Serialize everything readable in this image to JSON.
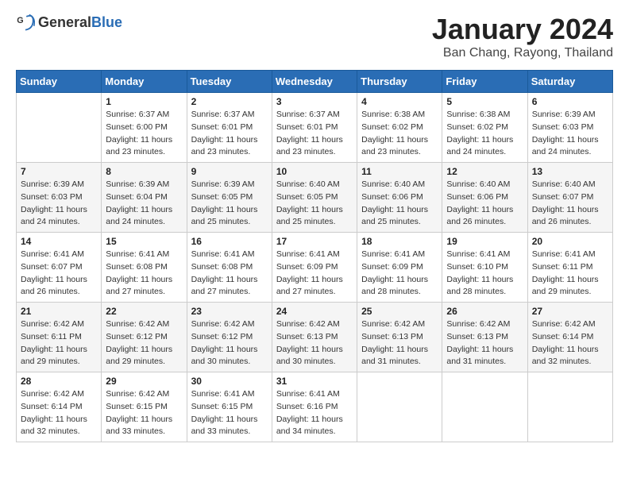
{
  "header": {
    "logo_general": "General",
    "logo_blue": "Blue",
    "main_title": "January 2024",
    "sub_title": "Ban Chang, Rayong, Thailand"
  },
  "days_of_week": [
    "Sunday",
    "Monday",
    "Tuesday",
    "Wednesday",
    "Thursday",
    "Friday",
    "Saturday"
  ],
  "weeks": [
    [
      {
        "num": "",
        "info": ""
      },
      {
        "num": "1",
        "info": "Sunrise: 6:37 AM\nSunset: 6:00 PM\nDaylight: 11 hours\nand 23 minutes."
      },
      {
        "num": "2",
        "info": "Sunrise: 6:37 AM\nSunset: 6:01 PM\nDaylight: 11 hours\nand 23 minutes."
      },
      {
        "num": "3",
        "info": "Sunrise: 6:37 AM\nSunset: 6:01 PM\nDaylight: 11 hours\nand 23 minutes."
      },
      {
        "num": "4",
        "info": "Sunrise: 6:38 AM\nSunset: 6:02 PM\nDaylight: 11 hours\nand 23 minutes."
      },
      {
        "num": "5",
        "info": "Sunrise: 6:38 AM\nSunset: 6:02 PM\nDaylight: 11 hours\nand 24 minutes."
      },
      {
        "num": "6",
        "info": "Sunrise: 6:39 AM\nSunset: 6:03 PM\nDaylight: 11 hours\nand 24 minutes."
      }
    ],
    [
      {
        "num": "7",
        "info": "Sunrise: 6:39 AM\nSunset: 6:03 PM\nDaylight: 11 hours\nand 24 minutes."
      },
      {
        "num": "8",
        "info": "Sunrise: 6:39 AM\nSunset: 6:04 PM\nDaylight: 11 hours\nand 24 minutes."
      },
      {
        "num": "9",
        "info": "Sunrise: 6:39 AM\nSunset: 6:05 PM\nDaylight: 11 hours\nand 25 minutes."
      },
      {
        "num": "10",
        "info": "Sunrise: 6:40 AM\nSunset: 6:05 PM\nDaylight: 11 hours\nand 25 minutes."
      },
      {
        "num": "11",
        "info": "Sunrise: 6:40 AM\nSunset: 6:06 PM\nDaylight: 11 hours\nand 25 minutes."
      },
      {
        "num": "12",
        "info": "Sunrise: 6:40 AM\nSunset: 6:06 PM\nDaylight: 11 hours\nand 26 minutes."
      },
      {
        "num": "13",
        "info": "Sunrise: 6:40 AM\nSunset: 6:07 PM\nDaylight: 11 hours\nand 26 minutes."
      }
    ],
    [
      {
        "num": "14",
        "info": "Sunrise: 6:41 AM\nSunset: 6:07 PM\nDaylight: 11 hours\nand 26 minutes."
      },
      {
        "num": "15",
        "info": "Sunrise: 6:41 AM\nSunset: 6:08 PM\nDaylight: 11 hours\nand 27 minutes."
      },
      {
        "num": "16",
        "info": "Sunrise: 6:41 AM\nSunset: 6:08 PM\nDaylight: 11 hours\nand 27 minutes."
      },
      {
        "num": "17",
        "info": "Sunrise: 6:41 AM\nSunset: 6:09 PM\nDaylight: 11 hours\nand 27 minutes."
      },
      {
        "num": "18",
        "info": "Sunrise: 6:41 AM\nSunset: 6:09 PM\nDaylight: 11 hours\nand 28 minutes."
      },
      {
        "num": "19",
        "info": "Sunrise: 6:41 AM\nSunset: 6:10 PM\nDaylight: 11 hours\nand 28 minutes."
      },
      {
        "num": "20",
        "info": "Sunrise: 6:41 AM\nSunset: 6:11 PM\nDaylight: 11 hours\nand 29 minutes."
      }
    ],
    [
      {
        "num": "21",
        "info": "Sunrise: 6:42 AM\nSunset: 6:11 PM\nDaylight: 11 hours\nand 29 minutes."
      },
      {
        "num": "22",
        "info": "Sunrise: 6:42 AM\nSunset: 6:12 PM\nDaylight: 11 hours\nand 29 minutes."
      },
      {
        "num": "23",
        "info": "Sunrise: 6:42 AM\nSunset: 6:12 PM\nDaylight: 11 hours\nand 30 minutes."
      },
      {
        "num": "24",
        "info": "Sunrise: 6:42 AM\nSunset: 6:13 PM\nDaylight: 11 hours\nand 30 minutes."
      },
      {
        "num": "25",
        "info": "Sunrise: 6:42 AM\nSunset: 6:13 PM\nDaylight: 11 hours\nand 31 minutes."
      },
      {
        "num": "26",
        "info": "Sunrise: 6:42 AM\nSunset: 6:13 PM\nDaylight: 11 hours\nand 31 minutes."
      },
      {
        "num": "27",
        "info": "Sunrise: 6:42 AM\nSunset: 6:14 PM\nDaylight: 11 hours\nand 32 minutes."
      }
    ],
    [
      {
        "num": "28",
        "info": "Sunrise: 6:42 AM\nSunset: 6:14 PM\nDaylight: 11 hours\nand 32 minutes."
      },
      {
        "num": "29",
        "info": "Sunrise: 6:42 AM\nSunset: 6:15 PM\nDaylight: 11 hours\nand 33 minutes."
      },
      {
        "num": "30",
        "info": "Sunrise: 6:41 AM\nSunset: 6:15 PM\nDaylight: 11 hours\nand 33 minutes."
      },
      {
        "num": "31",
        "info": "Sunrise: 6:41 AM\nSunset: 6:16 PM\nDaylight: 11 hours\nand 34 minutes."
      },
      {
        "num": "",
        "info": ""
      },
      {
        "num": "",
        "info": ""
      },
      {
        "num": "",
        "info": ""
      }
    ]
  ]
}
